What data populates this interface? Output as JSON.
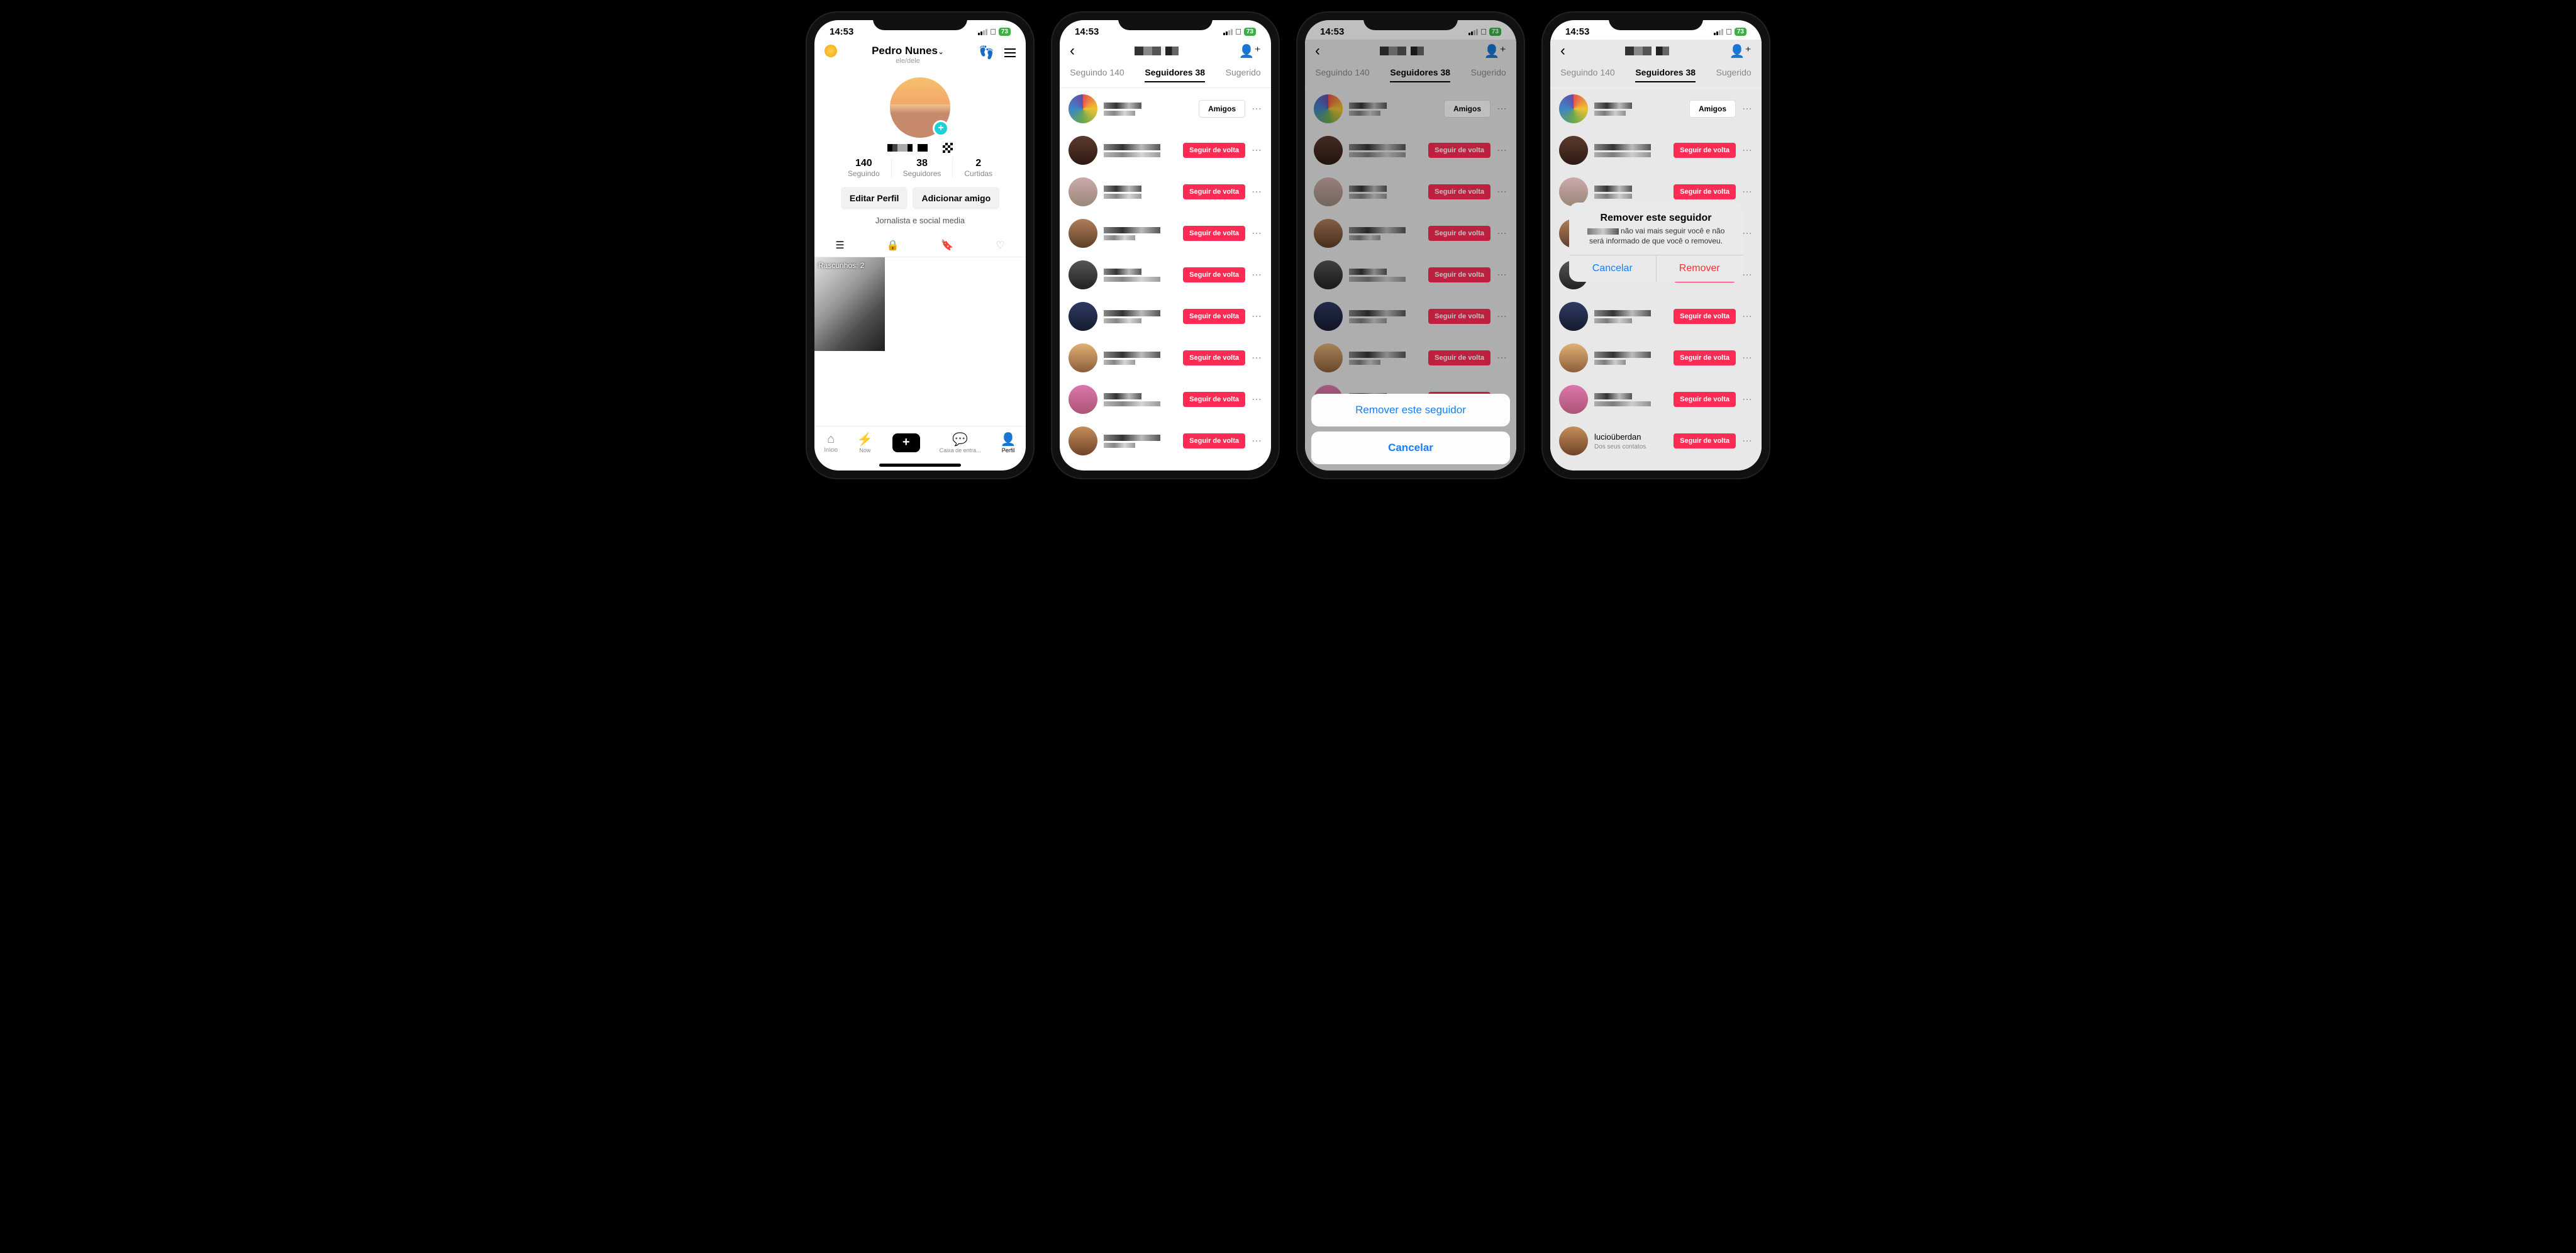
{
  "status": {
    "time": "14:53",
    "battery": "73"
  },
  "profile": {
    "name": "Pedro Nunes",
    "pronouns": "ele/dele",
    "stats": {
      "following_count": "140",
      "following_label": "Seguindo",
      "followers_count": "38",
      "followers_label": "Seguidores",
      "likes_count": "2",
      "likes_label": "Curtidas"
    },
    "edit_btn": "Editar Perfil",
    "add_friend_btn": "Adicionar amigo",
    "bio": "Jornalista e social media",
    "drafts_label": "Rascunhos: 2",
    "nav": {
      "home": "Início",
      "now": "Now",
      "inbox": "Caixa de entra...",
      "profile": "Perfil"
    }
  },
  "followers": {
    "tabs": {
      "following": "Seguindo 140",
      "followers": "Seguidores 38",
      "suggested": "Sugerido"
    },
    "friends_btn": "Amigos",
    "follow_back_btn": "Seguir de volta",
    "visible_username": "lucioüberdan",
    "contacts_hint": "Dos seus contatos"
  },
  "action_sheet": {
    "remove": "Remover este seguidor",
    "cancel": "Cancelar"
  },
  "alert": {
    "title": "Remover este seguidor",
    "msg_suffix": " não vai mais seguir você e não será informado de que você o removeu.",
    "cancel": "Cancelar",
    "remove": "Remover"
  }
}
